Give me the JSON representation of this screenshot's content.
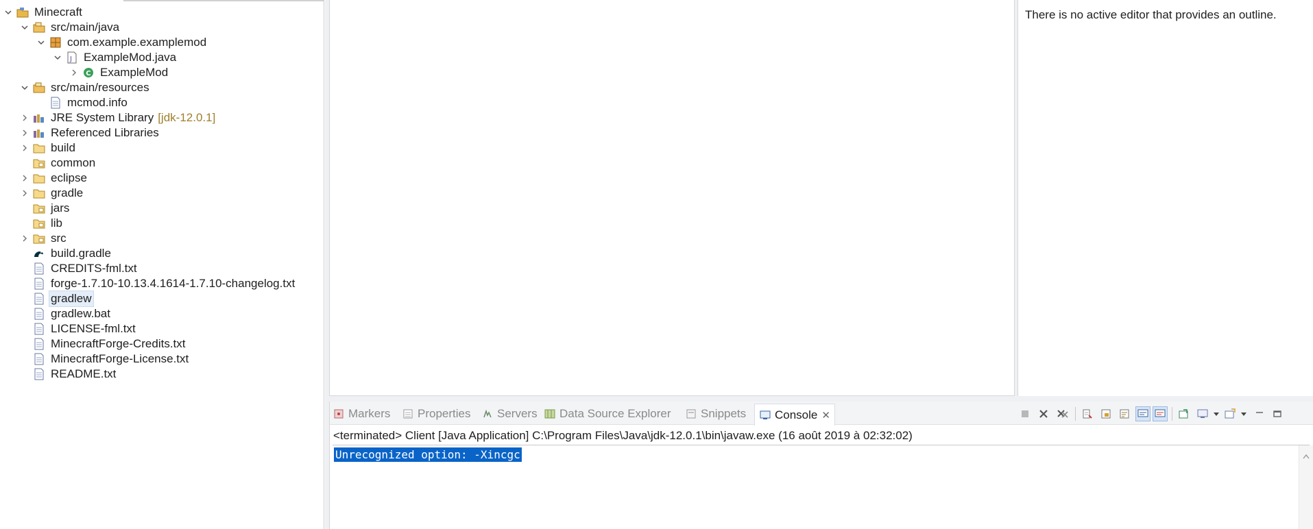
{
  "explorer": {
    "rows": [
      {
        "label": "Minecraft",
        "icon": "project-icon"
      },
      {
        "label": "src/main/java",
        "icon": "source-folder-icon"
      },
      {
        "label": "com.example.examplemod",
        "icon": "package-icon"
      },
      {
        "label": "ExampleMod.java",
        "icon": "java-file-icon"
      },
      {
        "label": "ExampleMod",
        "icon": "class-icon"
      },
      {
        "label": "src/main/resources",
        "icon": "source-folder-icon"
      },
      {
        "label": "mcmod.info",
        "icon": "file-icon"
      },
      {
        "label": "JRE System Library",
        "decoration": "[jdk-12.0.1]",
        "icon": "library-icon"
      },
      {
        "label": "Referenced Libraries",
        "icon": "library-icon"
      },
      {
        "label": "build",
        "icon": "folder-icon"
      },
      {
        "label": "common",
        "icon": "folder-icon"
      },
      {
        "label": "eclipse",
        "icon": "folder-icon"
      },
      {
        "label": "gradle",
        "icon": "folder-icon"
      },
      {
        "label": "jars",
        "icon": "folder-icon"
      },
      {
        "label": "lib",
        "icon": "folder-icon"
      },
      {
        "label": "src",
        "icon": "folder-icon"
      },
      {
        "label": "build.gradle",
        "icon": "gradle-icon"
      },
      {
        "label": "CREDITS-fml.txt",
        "icon": "text-file-icon"
      },
      {
        "label": "forge-1.7.10-10.13.4.1614-1.7.10-changelog.txt",
        "icon": "text-file-icon"
      },
      {
        "label": "gradlew",
        "icon": "text-file-icon",
        "selected": true
      },
      {
        "label": "gradlew.bat",
        "icon": "text-file-icon"
      },
      {
        "label": "LICENSE-fml.txt",
        "icon": "text-file-icon"
      },
      {
        "label": "MinecraftForge-Credits.txt",
        "icon": "text-file-icon"
      },
      {
        "label": "MinecraftForge-License.txt",
        "icon": "text-file-icon"
      },
      {
        "label": "README.txt",
        "icon": "text-file-icon"
      }
    ]
  },
  "outline": {
    "message": "There is no active editor that provides an outline."
  },
  "bottom": {
    "tabs": [
      {
        "label": "Markers",
        "icon": "markers-icon"
      },
      {
        "label": "Properties",
        "icon": "properties-icon"
      },
      {
        "label": "Servers",
        "icon": "servers-icon"
      },
      {
        "label": "Data Source Explorer",
        "icon": "data-source-icon"
      },
      {
        "label": "Snippets",
        "icon": "snippets-icon"
      },
      {
        "label": "Console",
        "icon": "console-icon",
        "active": true
      }
    ],
    "console_header": "<terminated> Client [Java Application] C:\\Program Files\\Java\\jdk-12.0.1\\bin\\javaw.exe (16 août 2019 à 02:32:02)",
    "console_output": "Unrecognized option: -Xincgc"
  },
  "colors": {
    "selection": "#0a64c8",
    "decoration": "#a07f2c",
    "inactive_tab_text": "#8a8a8a"
  }
}
